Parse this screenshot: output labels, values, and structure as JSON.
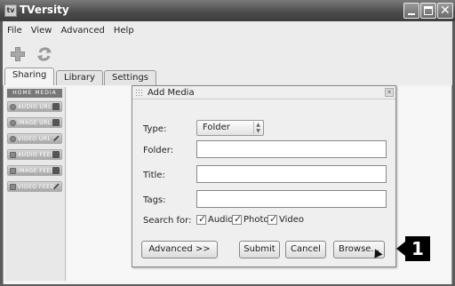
{
  "window": {
    "title": "TVersity",
    "icon": "tversity-logo-icon"
  },
  "menu": {
    "items": [
      "File",
      "View",
      "Advanced",
      "Help"
    ]
  },
  "toolbar": {
    "icons": [
      "add-media-icon",
      "refresh-icon"
    ]
  },
  "tabs": [
    "Sharing",
    "Library",
    "Settings"
  ],
  "left_panel": {
    "header": "HOME MEDIA",
    "buttons": [
      "AUDIO URL",
      "IMAGE URL",
      "VIDEO URL",
      "AUDIO FEED",
      "IMAGE FEED",
      "VIDEO FEED"
    ]
  },
  "dialog": {
    "title": "Add Media",
    "type_label": "Type:",
    "type_value": "Folder",
    "folder_label": "Folder:",
    "folder_value": "",
    "title_label": "Title:",
    "title_value": "",
    "tags_label": "Tags:",
    "tags_value": "",
    "search_label": "Search for:",
    "checkboxes": [
      {
        "label": "Audio",
        "checked": true
      },
      {
        "label": "Photo",
        "checked": true
      },
      {
        "label": "Video",
        "checked": true
      }
    ],
    "buttons": {
      "advanced": "Advanced >>",
      "submit": "Submit",
      "cancel": "Cancel",
      "browse": "Browse..."
    }
  },
  "callout": {
    "number": "1"
  },
  "colors": {
    "titlebar": "#4a4a4a",
    "callout": "#000000"
  }
}
